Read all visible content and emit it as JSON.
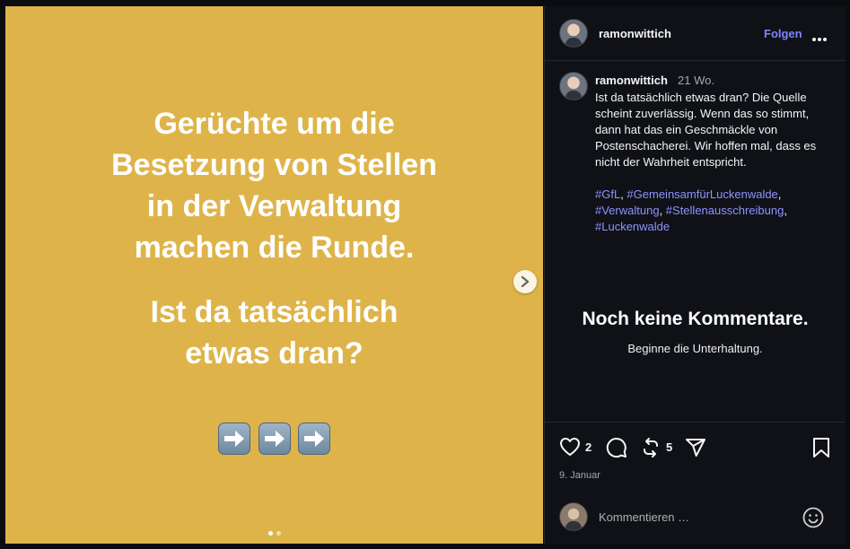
{
  "slide": {
    "lines1": [
      "Gerüchte um die",
      "Besetzung von Stellen",
      "in der Verwaltung",
      "machen die Runde."
    ],
    "lines2": [
      "Ist da tatsächlich",
      "etwas dran?"
    ],
    "arrow_count": 3,
    "dots": 2,
    "active_dot": 0
  },
  "post": {
    "username": "ramonwittich",
    "follow_label": "Folgen",
    "time": "21 Wo.",
    "caption": "Ist da tatsächlich etwas dran? Die Quelle scheint zuverlässig. Wenn das so stimmt, dann hat das ein Geschmäckle von Postenschacherei. Wir hoffen mal, dass es nicht der Wahrheit entspricht.",
    "hashtags": [
      "#GfL",
      "#GemeinsamfürLuckenwalde",
      "#Verwaltung",
      "#Stellenausschreibung",
      "#Luckenwalde"
    ]
  },
  "comments": {
    "empty_title": "Noch keine Kommentare.",
    "empty_subtitle": "Beginne die Unterhaltung."
  },
  "actions": {
    "likes": "2",
    "reposts": "5",
    "date": "9. Januar"
  },
  "comment_input": {
    "placeholder": "Kommentieren …"
  },
  "colors": {
    "slide_bg": "#deb44a",
    "link": "#8e93ff",
    "follow": "#7e85ff"
  }
}
